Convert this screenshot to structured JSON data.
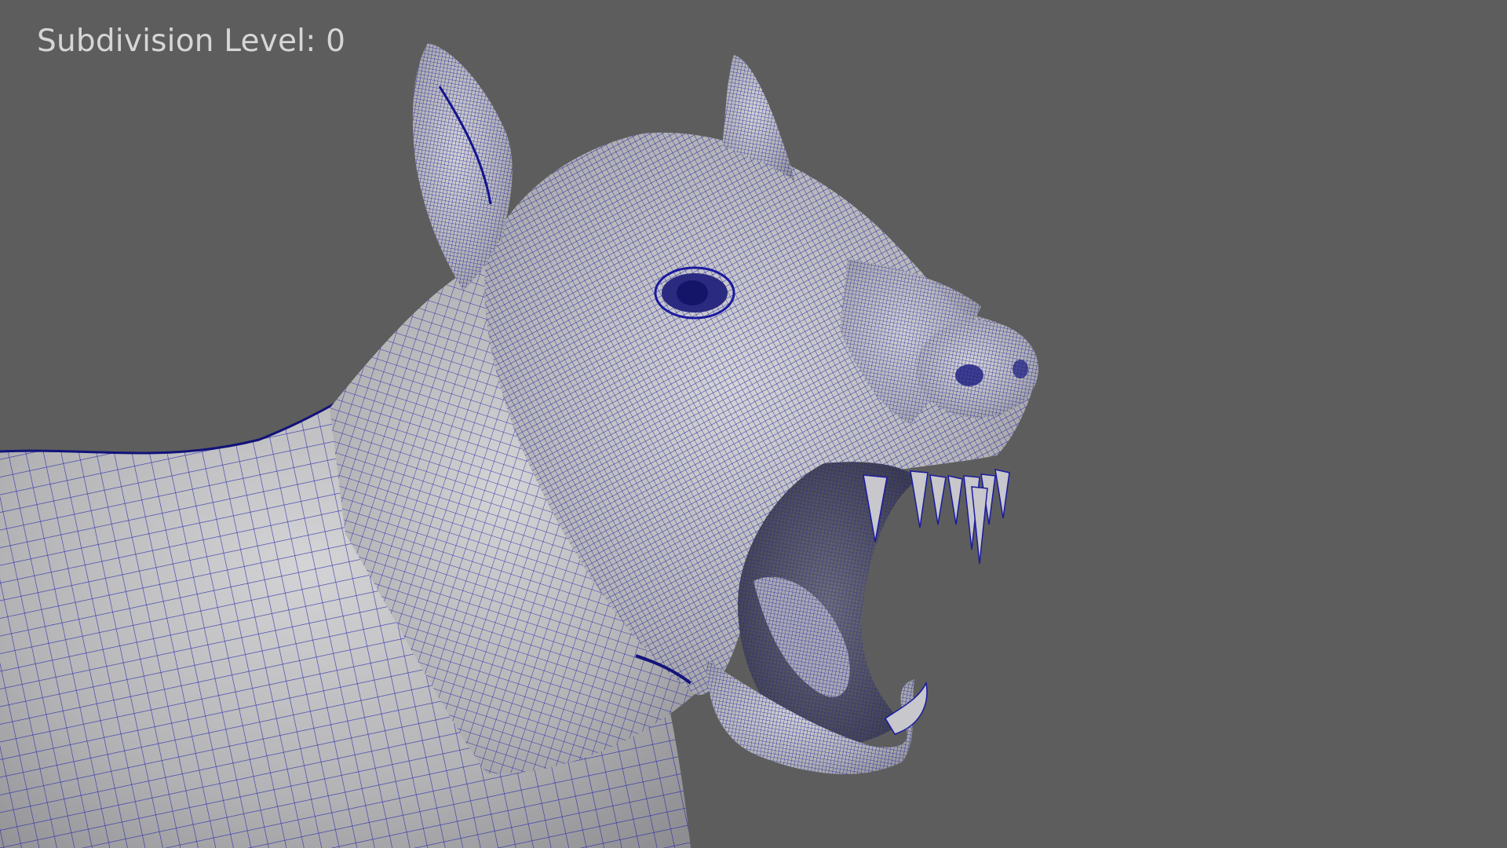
{
  "viewport": {
    "hud": {
      "label": "Subdivision Level: 0"
    },
    "model": {
      "subject": "wireframe-dog-head",
      "wire_color": "#1a1aa0",
      "surface_color": "#b9b9bb",
      "background_color": "#5d5d5d"
    }
  }
}
